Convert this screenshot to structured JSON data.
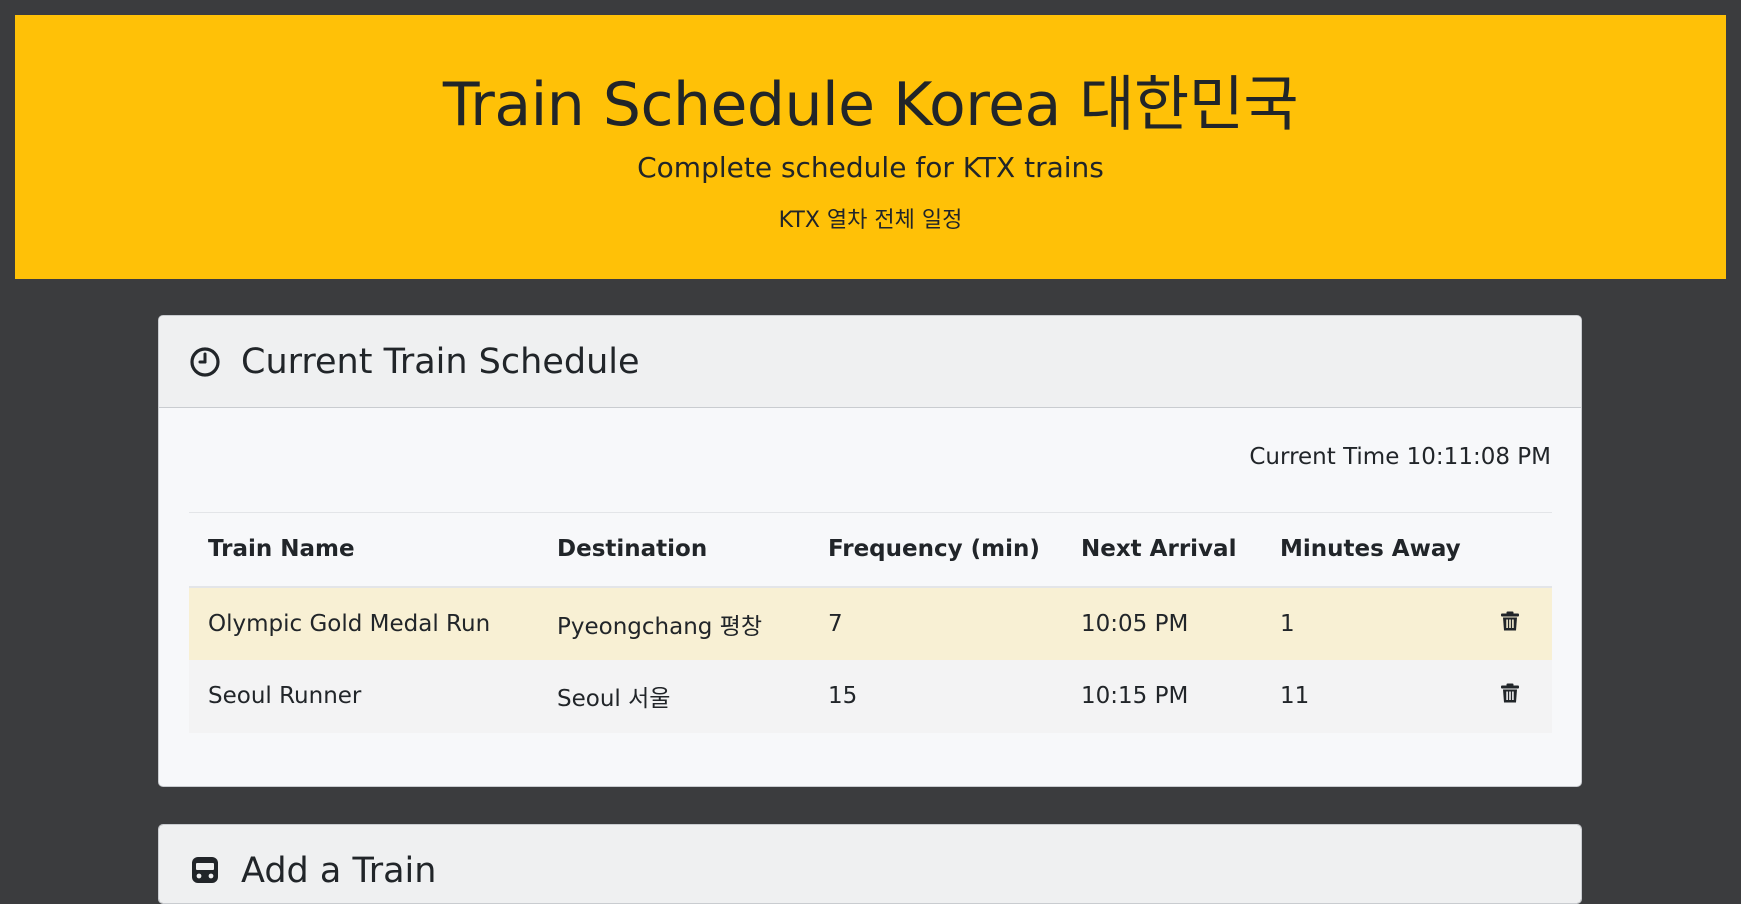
{
  "header": {
    "title": "Train Schedule Korea 대한민국",
    "subtitle": "Complete schedule for KTX trains",
    "subtitle_ko": "KTX 열차 전체 일정"
  },
  "schedule": {
    "title": "Current Train Schedule",
    "icon": "clock-icon",
    "current_time": "Current Time 10:11:08 PM",
    "columns": {
      "name": "Train Name",
      "destination": "Destination",
      "frequency": "Frequency (min)",
      "next": "Next Arrival",
      "minutes": "Minutes Away"
    },
    "rows": [
      {
        "name": "Olympic Gold Medal Run",
        "destination": "Pyeongchang 평창",
        "frequency": "7",
        "next": "10:05 PM",
        "minutes": "1"
      },
      {
        "name": "Seoul Runner",
        "destination": "Seoul 서울",
        "frequency": "15",
        "next": "10:15 PM",
        "minutes": "11"
      }
    ]
  },
  "add_train": {
    "title": "Add a Train",
    "icon": "train-icon"
  },
  "colors": {
    "banner": "#ffc107",
    "background": "#3b3c3e",
    "highlight_row": "#f8f0d4"
  }
}
